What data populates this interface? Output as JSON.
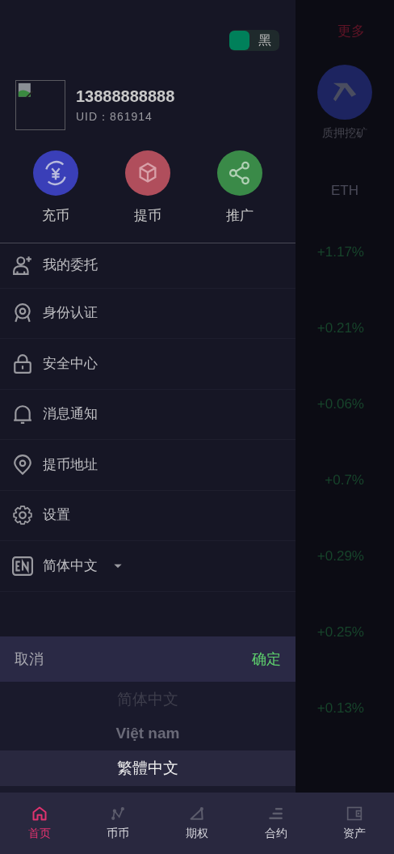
{
  "background_page": {
    "more": "更多",
    "feature": "质押挖矿",
    "column": "ETH",
    "changes": [
      "+1.17%",
      "+0.21%",
      "+0.06%",
      "+0.7%",
      "+0.29%",
      "+0.25%",
      "+0.13%"
    ]
  },
  "theme_toggle": {
    "on": true,
    "label": "黑"
  },
  "profile": {
    "phone": "13888888888",
    "uid": "UID：861914"
  },
  "quick_actions": [
    {
      "label": "充币",
      "kind": "deposit"
    },
    {
      "label": "提币",
      "kind": "withdraw"
    },
    {
      "label": "推广",
      "kind": "share"
    }
  ],
  "menu": [
    {
      "label": "我的委托",
      "kind": "user-add"
    },
    {
      "label": "身份认证",
      "kind": "identity"
    },
    {
      "label": "安全中心",
      "kind": "lock"
    },
    {
      "label": "消息通知",
      "kind": "bell"
    },
    {
      "label": "提币地址",
      "kind": "location"
    },
    {
      "label": "设置",
      "kind": "settings"
    },
    {
      "label": "简体中文",
      "kind": "language"
    }
  ],
  "language_picker": {
    "cancel": "取消",
    "confirm": "确定",
    "options": [
      {
        "label": "简体中文",
        "selected": false
      },
      {
        "label": "Việt nam",
        "selected": false
      },
      {
        "label": "繁體中文",
        "selected": true
      }
    ]
  },
  "bottom_nav": [
    {
      "label": "首页",
      "kind": "home",
      "selected": true
    },
    {
      "label": "币币",
      "kind": "spot",
      "selected": false
    },
    {
      "label": "期权",
      "kind": "options",
      "selected": false
    },
    {
      "label": "合约",
      "kind": "contract",
      "selected": false
    },
    {
      "label": "资产",
      "kind": "wallet",
      "selected": false
    }
  ]
}
